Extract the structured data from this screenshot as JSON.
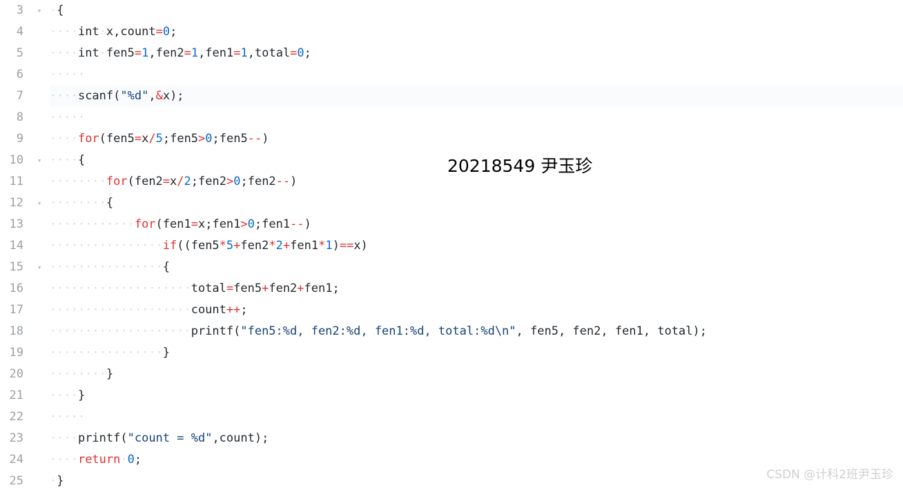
{
  "editor": {
    "first_line_number": 3,
    "current_line": 7,
    "colors": {
      "background": "#ffffff",
      "keyword": "#e03030",
      "operator": "#e03030",
      "number": "#0b66d0",
      "string": "#16417a",
      "plain": "#24292e",
      "line_number": "#9aa0a6",
      "indent_dot": "#d8dce0",
      "current_line_bg": "#fafbfc",
      "fold_arrow": "#b5bcc4"
    },
    "fold_icon": "▾",
    "lines": [
      {
        "number": "3",
        "fold": true,
        "tokens": [
          {
            "t": "ws",
            "v": "·"
          },
          {
            "t": "pln",
            "v": "{"
          }
        ]
      },
      {
        "number": "4",
        "fold": false,
        "tokens": [
          {
            "t": "ws",
            "v": "····"
          },
          {
            "t": "pln",
            "v": "int"
          },
          {
            "t": "ws",
            "v": "·"
          },
          {
            "t": "pln",
            "v": "x,count"
          },
          {
            "t": "op",
            "v": "="
          },
          {
            "t": "num",
            "v": "0"
          },
          {
            "t": "pln",
            "v": ";"
          }
        ]
      },
      {
        "number": "5",
        "fold": false,
        "tokens": [
          {
            "t": "ws",
            "v": "····"
          },
          {
            "t": "pln",
            "v": "int"
          },
          {
            "t": "ws",
            "v": "·"
          },
          {
            "t": "pln",
            "v": "fen5"
          },
          {
            "t": "op",
            "v": "="
          },
          {
            "t": "num",
            "v": "1"
          },
          {
            "t": "pln",
            "v": ",fen2"
          },
          {
            "t": "op",
            "v": "="
          },
          {
            "t": "num",
            "v": "1"
          },
          {
            "t": "pln",
            "v": ",fen1"
          },
          {
            "t": "op",
            "v": "="
          },
          {
            "t": "num",
            "v": "1"
          },
          {
            "t": "pln",
            "v": ",total"
          },
          {
            "t": "op",
            "v": "="
          },
          {
            "t": "num",
            "v": "0"
          },
          {
            "t": "pln",
            "v": ";"
          }
        ]
      },
      {
        "number": "6",
        "fold": false,
        "tokens": [
          {
            "t": "ws",
            "v": "·····"
          }
        ]
      },
      {
        "number": "7",
        "fold": false,
        "current": true,
        "tokens": [
          {
            "t": "ws",
            "v": "····"
          },
          {
            "t": "pln",
            "v": "scanf("
          },
          {
            "t": "str",
            "v": "\"%d\""
          },
          {
            "t": "pln",
            "v": ","
          },
          {
            "t": "op",
            "v": "&"
          },
          {
            "t": "pln",
            "v": "x);"
          }
        ]
      },
      {
        "number": "8",
        "fold": false,
        "tokens": [
          {
            "t": "ws",
            "v": "·····"
          }
        ]
      },
      {
        "number": "9",
        "fold": false,
        "tokens": [
          {
            "t": "ws",
            "v": "····"
          },
          {
            "t": "kw",
            "v": "for"
          },
          {
            "t": "pln",
            "v": "(fen5"
          },
          {
            "t": "op",
            "v": "="
          },
          {
            "t": "pln",
            "v": "x"
          },
          {
            "t": "op",
            "v": "/"
          },
          {
            "t": "num",
            "v": "5"
          },
          {
            "t": "pln",
            "v": ";fen5"
          },
          {
            "t": "op",
            "v": ">"
          },
          {
            "t": "num",
            "v": "0"
          },
          {
            "t": "pln",
            "v": ";fen5"
          },
          {
            "t": "op",
            "v": "--"
          },
          {
            "t": "pln",
            "v": ")"
          }
        ]
      },
      {
        "number": "10",
        "fold": true,
        "tokens": [
          {
            "t": "ws",
            "v": "····"
          },
          {
            "t": "pln",
            "v": "{"
          }
        ]
      },
      {
        "number": "11",
        "fold": false,
        "tokens": [
          {
            "t": "ws",
            "v": "········"
          },
          {
            "t": "kw",
            "v": "for"
          },
          {
            "t": "pln",
            "v": "(fen2"
          },
          {
            "t": "op",
            "v": "="
          },
          {
            "t": "pln",
            "v": "x"
          },
          {
            "t": "op",
            "v": "/"
          },
          {
            "t": "num",
            "v": "2"
          },
          {
            "t": "pln",
            "v": ";fen2"
          },
          {
            "t": "op",
            "v": ">"
          },
          {
            "t": "num",
            "v": "0"
          },
          {
            "t": "pln",
            "v": ";fen2"
          },
          {
            "t": "op",
            "v": "--"
          },
          {
            "t": "pln",
            "v": ")"
          }
        ]
      },
      {
        "number": "12",
        "fold": true,
        "tokens": [
          {
            "t": "ws",
            "v": "········"
          },
          {
            "t": "pln",
            "v": "{"
          }
        ]
      },
      {
        "number": "13",
        "fold": false,
        "tokens": [
          {
            "t": "ws",
            "v": "············"
          },
          {
            "t": "kw",
            "v": "for"
          },
          {
            "t": "pln",
            "v": "(fen1"
          },
          {
            "t": "op",
            "v": "="
          },
          {
            "t": "pln",
            "v": "x;fen1"
          },
          {
            "t": "op",
            "v": ">"
          },
          {
            "t": "num",
            "v": "0"
          },
          {
            "t": "pln",
            "v": ";fen1"
          },
          {
            "t": "op",
            "v": "--"
          },
          {
            "t": "pln",
            "v": ")"
          }
        ]
      },
      {
        "number": "14",
        "fold": false,
        "tokens": [
          {
            "t": "ws",
            "v": "················"
          },
          {
            "t": "kw",
            "v": "if"
          },
          {
            "t": "pln",
            "v": "((fen5"
          },
          {
            "t": "op",
            "v": "*"
          },
          {
            "t": "num",
            "v": "5"
          },
          {
            "t": "op",
            "v": "+"
          },
          {
            "t": "pln",
            "v": "fen2"
          },
          {
            "t": "op",
            "v": "*"
          },
          {
            "t": "num",
            "v": "2"
          },
          {
            "t": "op",
            "v": "+"
          },
          {
            "t": "pln",
            "v": "fen1"
          },
          {
            "t": "op",
            "v": "*"
          },
          {
            "t": "num",
            "v": "1"
          },
          {
            "t": "pln",
            "v": ")"
          },
          {
            "t": "op",
            "v": "=="
          },
          {
            "t": "pln",
            "v": "x)"
          }
        ]
      },
      {
        "number": "15",
        "fold": true,
        "tokens": [
          {
            "t": "ws",
            "v": "················"
          },
          {
            "t": "pln",
            "v": "{"
          }
        ]
      },
      {
        "number": "16",
        "fold": false,
        "tokens": [
          {
            "t": "ws",
            "v": "····················"
          },
          {
            "t": "pln",
            "v": "total"
          },
          {
            "t": "op",
            "v": "="
          },
          {
            "t": "pln",
            "v": "fen5"
          },
          {
            "t": "op",
            "v": "+"
          },
          {
            "t": "pln",
            "v": "fen2"
          },
          {
            "t": "op",
            "v": "+"
          },
          {
            "t": "pln",
            "v": "fen1;"
          }
        ]
      },
      {
        "number": "17",
        "fold": false,
        "tokens": [
          {
            "t": "ws",
            "v": "····················"
          },
          {
            "t": "pln",
            "v": "count"
          },
          {
            "t": "op",
            "v": "++"
          },
          {
            "t": "pln",
            "v": ";"
          }
        ]
      },
      {
        "number": "18",
        "fold": false,
        "tokens": [
          {
            "t": "ws",
            "v": "····················"
          },
          {
            "t": "pln",
            "v": "printf("
          },
          {
            "t": "str",
            "v": "\"fen5:%d, fen2:%d, fen1:%d, total:%d\\n\""
          },
          {
            "t": "pln",
            "v": ", fen5, fen2, fen1, total);"
          }
        ]
      },
      {
        "number": "19",
        "fold": false,
        "tokens": [
          {
            "t": "ws",
            "v": "················"
          },
          {
            "t": "pln",
            "v": "}"
          }
        ]
      },
      {
        "number": "20",
        "fold": false,
        "tokens": [
          {
            "t": "ws",
            "v": "········"
          },
          {
            "t": "pln",
            "v": "}"
          }
        ]
      },
      {
        "number": "21",
        "fold": false,
        "tokens": [
          {
            "t": "ws",
            "v": "····"
          },
          {
            "t": "pln",
            "v": "}"
          }
        ]
      },
      {
        "number": "22",
        "fold": false,
        "tokens": [
          {
            "t": "ws",
            "v": "·····"
          }
        ]
      },
      {
        "number": "23",
        "fold": false,
        "tokens": [
          {
            "t": "ws",
            "v": "····"
          },
          {
            "t": "pln",
            "v": "printf("
          },
          {
            "t": "str",
            "v": "\"count = %d\""
          },
          {
            "t": "pln",
            "v": ",count);"
          }
        ]
      },
      {
        "number": "24",
        "fold": false,
        "tokens": [
          {
            "t": "ws",
            "v": "····"
          },
          {
            "t": "kw",
            "v": "return"
          },
          {
            "t": "ws",
            "v": "·"
          },
          {
            "t": "num",
            "v": "0"
          },
          {
            "t": "pln",
            "v": ";"
          }
        ]
      },
      {
        "number": "25",
        "fold": false,
        "tokens": [
          {
            "t": "ws",
            "v": "·"
          },
          {
            "t": "pln",
            "v": "}"
          }
        ]
      }
    ]
  },
  "overlays": {
    "student_label": "20218549 尹玉珍",
    "watermark": "CSDN @计科2班尹玉珍"
  }
}
